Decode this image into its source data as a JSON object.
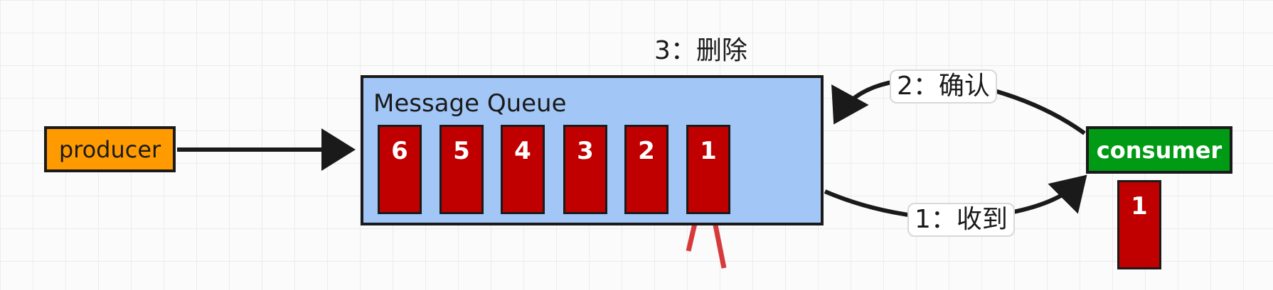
{
  "producer": {
    "label": "producer"
  },
  "queue": {
    "title": "Message Queue",
    "messages": [
      "6",
      "5",
      "4",
      "3",
      "2",
      "1"
    ]
  },
  "consumer": {
    "label": "consumer",
    "received_message": "1"
  },
  "steps": {
    "receive": "1：收到",
    "ack": "2：确认",
    "delete": "3：删除"
  },
  "colors": {
    "producer": "#ff9a00",
    "queue": "#a2c7f7",
    "message": "#c00000",
    "consumer": "#009a14",
    "delete_mark": "#d63a3a"
  }
}
